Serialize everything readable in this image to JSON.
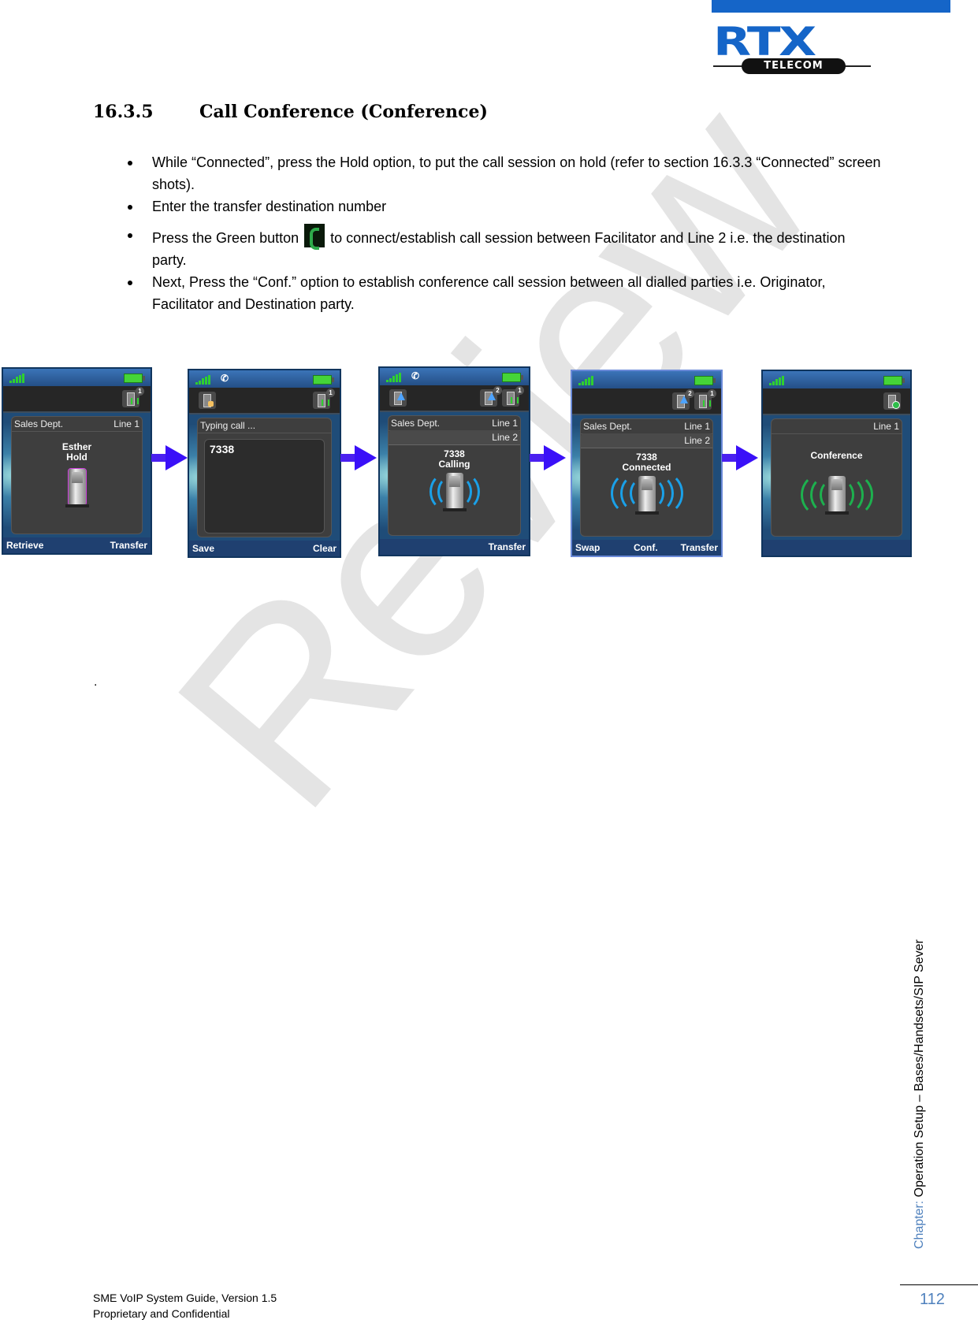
{
  "header": {
    "logo_main": "RTX",
    "logo_sub": "TELECOM",
    "brand_color": "#1565c8"
  },
  "section": {
    "number": "16.3.5",
    "title": "Call Conference (Conference)"
  },
  "bullets": [
    {
      "text": "While “Connected”, press the Hold option, to put the call session on hold (refer to section 16.3.3 “Connected” screen shots)."
    },
    {
      "text": "Enter the transfer destination number"
    },
    {
      "text_before": "Press the Green button",
      "icon": "green-call-button-icon",
      "text_after": "to connect/establish call session between Facilitator and Line 2 i.e. the destination party."
    },
    {
      "text": "Next, Press the “Conf.” option to establish conference call session between all dialled parties i.e. Originator, Facilitator and Destination party."
    }
  ],
  "screens": [
    {
      "name": "hold",
      "toolbar_icons": [
        {
          "icon": "line-active-icon",
          "badge": "1"
        }
      ],
      "header_left": "Sales Dept.",
      "header_right": "Line 1",
      "title_line1": "Esther",
      "title_line2": "Hold",
      "softkeys": {
        "left": "Retrieve",
        "right": "Transfer"
      }
    },
    {
      "name": "typing",
      "toolbar_icons": [
        {
          "icon": "dial-hand-icon"
        },
        {
          "icon": "line-active-icon",
          "badge": "1"
        }
      ],
      "header_left": "Typing call ...",
      "typed_number": "7338",
      "softkeys": {
        "left": "Save",
        "right": "Clear"
      }
    },
    {
      "name": "calling",
      "toolbar_icons": [
        {
          "icon": "outgoing-call-icon"
        },
        {
          "icon": "outgoing-call-icon",
          "badge": "2"
        },
        {
          "icon": "line-active-icon",
          "badge": "1"
        }
      ],
      "header_left": "Sales Dept.",
      "header_right": "Line 1",
      "subheader_right": "Line 2",
      "title_line1": "7338",
      "title_line2": "Calling",
      "softkeys": {
        "right": "Transfer"
      }
    },
    {
      "name": "connected",
      "toolbar_icons": [
        {
          "icon": "outgoing-call-icon",
          "badge": "2"
        },
        {
          "icon": "line-active-icon",
          "badge": "1"
        }
      ],
      "header_left": "Sales Dept.",
      "header_right": "Line 1",
      "subheader_right": "Line 2",
      "title_line1": "7338",
      "title_line2": "Connected",
      "softkeys": {
        "left": "Swap",
        "middle": "Conf.",
        "right": "Transfer"
      }
    },
    {
      "name": "conference",
      "toolbar_icons": [
        {
          "icon": "conference-icon"
        }
      ],
      "header_right": "Line 1",
      "title_line1": "Conference"
    }
  ],
  "stray_mark": ".",
  "watermark": "Review",
  "footer": {
    "line1": "SME VoIP System Guide, Version 1.5",
    "line2": "Proprietary and Confidential"
  },
  "sidebar": {
    "chapter_label": "Chapter: ",
    "chapter_text": "Operation Setup – Bases/Handsets/SIP Sever",
    "page_number": "112"
  },
  "colors": {
    "accent_blue": "#4f81bd",
    "arrow": "#3a10f8",
    "wave_blue": "#1aa0e8",
    "wave_green": "#1db04e"
  }
}
